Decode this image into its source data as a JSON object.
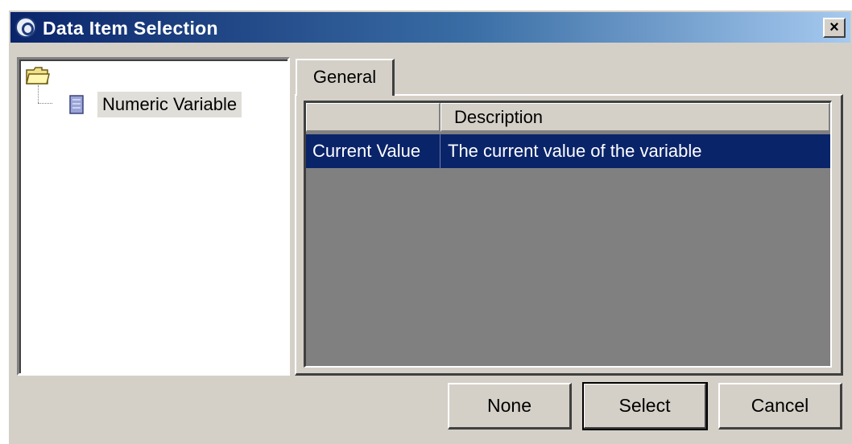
{
  "window": {
    "title": "Data Item Selection",
    "close_label": "×"
  },
  "tree": {
    "root_icon": "folder-icon",
    "items": [
      {
        "label": "Numeric Variable",
        "icon": "variable-icon"
      }
    ]
  },
  "tabs": [
    {
      "label": "General"
    }
  ],
  "table": {
    "columns": [
      "",
      "Description"
    ],
    "rows": [
      {
        "name": "Current Value",
        "description": "The current value of the variable",
        "selected": true
      }
    ]
  },
  "buttons": {
    "none": "None",
    "select": "Select",
    "cancel": "Cancel"
  },
  "colors": {
    "selection": "#0a246a",
    "panel": "#d4d0c8",
    "table_bg": "#808080"
  }
}
